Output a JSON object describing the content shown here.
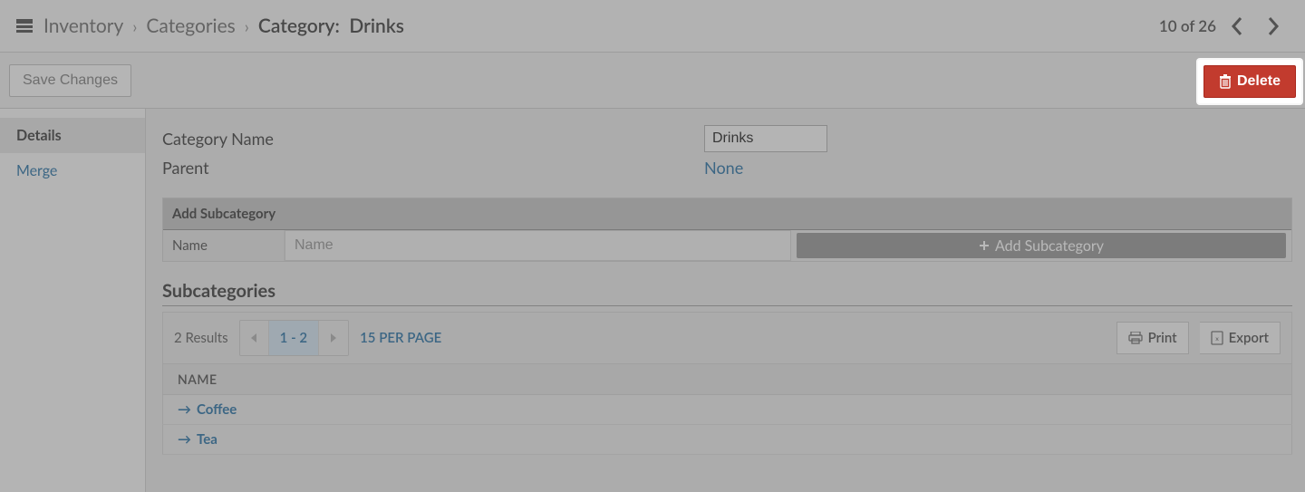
{
  "breadcrumb": {
    "items": [
      "Inventory",
      "Categories"
    ],
    "current_prefix": "Category:",
    "current_value": "Drinks"
  },
  "pager_top": {
    "text": "10 of 26"
  },
  "actions": {
    "save": "Save Changes",
    "delete": "Delete"
  },
  "sidebar": {
    "tabs": [
      {
        "label": "Details",
        "active": true
      },
      {
        "label": "Merge",
        "active": false
      }
    ]
  },
  "fields": {
    "category_name_label": "Category Name",
    "category_name_value": "Drinks",
    "parent_label": "Parent",
    "parent_value": "None"
  },
  "add_sub": {
    "title": "Add Subcategory",
    "name_label": "Name",
    "name_placeholder": "Name",
    "button": "Add Subcategory"
  },
  "subcats": {
    "heading": "Subcategories",
    "results_text": "2 Results",
    "page_range": "1 - 2",
    "per_page": "15 PER PAGE",
    "print": "Print",
    "export": "Export",
    "column": "NAME",
    "rows": [
      {
        "name": "Coffee"
      },
      {
        "name": "Tea"
      }
    ]
  }
}
